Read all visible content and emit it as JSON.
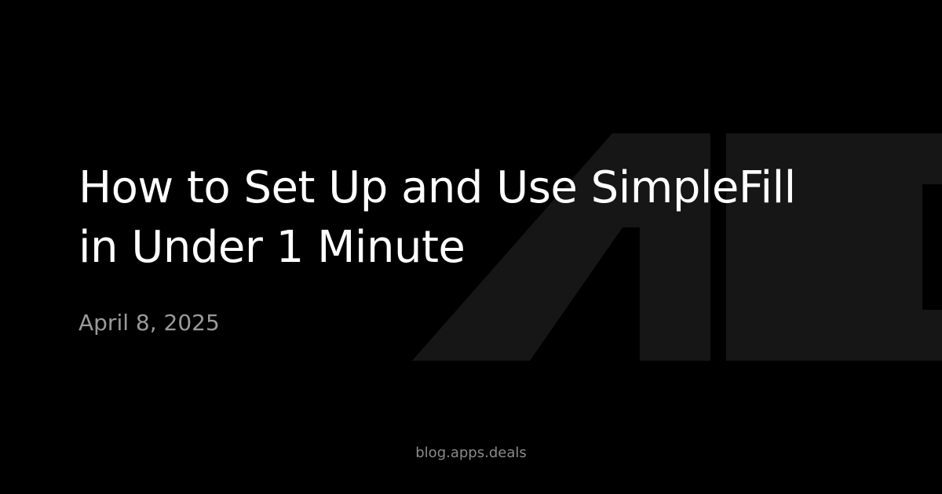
{
  "post": {
    "title_line1": "How to Set Up and Use SimpleFill",
    "title_line2": "in Under 1 Minute",
    "date": "April 8, 2025"
  },
  "footer": {
    "site": "blog.apps.deals"
  },
  "colors": {
    "background": "#000000",
    "title": "#ffffff",
    "date": "#9a9a9a",
    "site": "#8a8a8a",
    "logo_mark": "#161616"
  },
  "icons": {
    "background_logo": "apps-deals-logo-mark"
  }
}
